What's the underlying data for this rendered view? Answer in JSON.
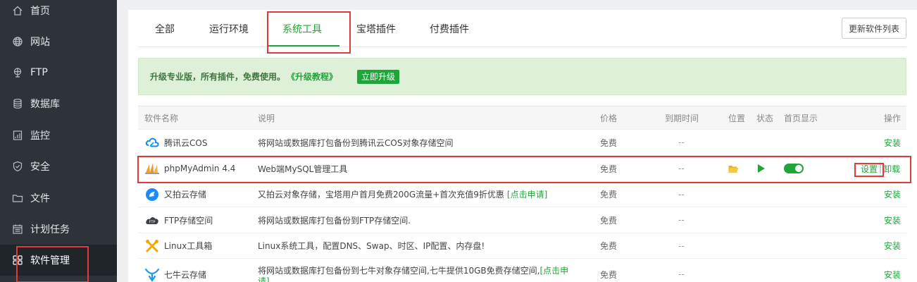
{
  "sidebar": {
    "items": [
      {
        "label": "首页",
        "icon": "home-icon"
      },
      {
        "label": "网站",
        "icon": "globe-icon"
      },
      {
        "label": "FTP",
        "icon": "ftp-icon"
      },
      {
        "label": "数据库",
        "icon": "database-icon"
      },
      {
        "label": "监控",
        "icon": "monitor-icon"
      },
      {
        "label": "安全",
        "icon": "shield-icon"
      },
      {
        "label": "文件",
        "icon": "folder-icon"
      },
      {
        "label": "计划任务",
        "icon": "calendar-icon"
      },
      {
        "label": "软件管理",
        "icon": "grid-icon",
        "active": true
      }
    ]
  },
  "tabs": {
    "all": "全部",
    "runtime": "运行环境",
    "system_tools": "系统工具",
    "bt_plugins": "宝塔插件",
    "paid_plugins": "付费插件",
    "active": "系统工具"
  },
  "toolbar": {
    "refresh_label": "更新软件列表"
  },
  "promo": {
    "text": "升级专业版，所有插件，免费使用。",
    "link": "《升级教程》",
    "button": "立即升级"
  },
  "table": {
    "headers": {
      "name": "软件名称",
      "desc": "说明",
      "price": "价格",
      "expire": "到期时间",
      "location": "位置",
      "status": "状态",
      "homepage": "首页显示",
      "action": "操作"
    },
    "rows": [
      {
        "name": "腾讯云COS",
        "icon": "tencent-cloud-icon",
        "desc": "将网站或数据库打包备份到腾讯云COS对象存储空间",
        "price": "免费",
        "expire": "--",
        "action": "安装"
      },
      {
        "name": "phpMyAdmin 4.4",
        "icon": "phpmyadmin-icon",
        "desc": "Web端MySQL管理工具",
        "price": "免费",
        "expire": "--",
        "location_icon": "folder-open-icon",
        "status_icon": "play-icon",
        "homepage_toggle": "on",
        "action_set": "设置",
        "action_sep": "|",
        "action_uninstall": "卸载"
      },
      {
        "name": "又拍云存储",
        "icon": "upyun-icon",
        "desc": "又拍云对象存储，宝塔用户首月免费200G流量+首次充值9折优惠",
        "desc_link": "[点击申请]",
        "price": "免费",
        "expire": "--",
        "action": "安装"
      },
      {
        "name": "FTP存储空间",
        "icon": "ftp-cloud-icon",
        "desc": "将网站或数据库打包备份到FTP存储空间.",
        "price": "免费",
        "expire": "--",
        "action": "安装"
      },
      {
        "name": "Linux工具箱",
        "icon": "tools-icon",
        "desc": "Linux系统工具，配置DNS、Swap、时区、IP配置、内存盘!",
        "price": "免费",
        "expire": "--",
        "action": "安装"
      },
      {
        "name": "七牛云存储",
        "icon": "qiniu-icon",
        "desc": "将网站或数据库打包备份到七牛对象存储空间,七牛提供10GB免费存储空间,",
        "desc_link": "[点击申",
        "desc_link_cont": "请]",
        "price": "免费",
        "expire": "--",
        "action": "安装"
      }
    ]
  },
  "colors": {
    "accent": "#20a53a",
    "sidebar_bg": "#2d3338",
    "highlight": "#e23a3a"
  }
}
